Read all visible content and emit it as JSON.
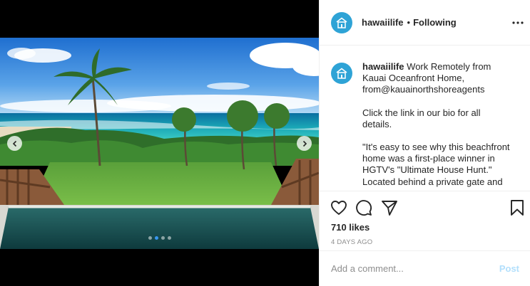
{
  "post": {
    "username": "hawaiilife",
    "separator": "•",
    "follow_status": "Following",
    "image_alt": "Oceanfront home with infinity pool, lawn, palm trees and ocean view"
  },
  "caption": {
    "username": "hawaiilife",
    "line1": "Work Remotely from Kauai Oceanfront Home, from@kauainorthshoreagents",
    "para2": "Click the link in our bio for all details.",
    "para3": "\"It's easy to see why this beachfront home was a first-place winner in HGTV's \"Ultimate House Hunt.\" Located behind a private gate and"
  },
  "stats": {
    "likes": "710 likes",
    "timestamp": "4 DAYS AGO"
  },
  "comment": {
    "placeholder": "Add a comment...",
    "post_label": "Post"
  },
  "carousel": {
    "slide_count": 4,
    "active_index": 1
  },
  "icons": {
    "avatar": "house-logo-icon",
    "more": "more-options-icon",
    "like": "heart-icon",
    "comment": "comment-bubble-icon",
    "share": "paper-plane-icon",
    "save": "bookmark-icon",
    "prev": "chevron-left-icon",
    "next": "chevron-right-icon"
  },
  "colors": {
    "avatar_bg": "#2ea3d6",
    "active_dot": "#3897f0",
    "post_disabled": "#b2dffc"
  }
}
